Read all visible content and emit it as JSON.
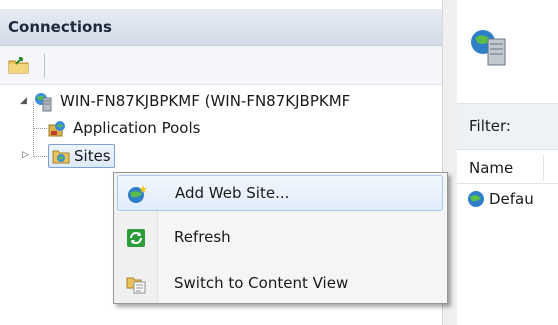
{
  "connections": {
    "title": "Connections",
    "toolbar": {
      "connect_icon": "folder-connect-icon"
    },
    "tree": {
      "server": {
        "label": "WIN-FN87KJBPKMF (WIN-FN87KJBPKMF",
        "icon": "server-icon"
      },
      "app_pools": {
        "label": "Application Pools",
        "icon": "app-pools-icon"
      },
      "sites": {
        "label": "Sites",
        "icon": "sites-folder-icon"
      }
    }
  },
  "main": {
    "icon": "server-icon",
    "filter_label": "Filter:",
    "columns": [
      "Name"
    ],
    "rows": [
      {
        "name": "Defau",
        "icon": "globe-icon"
      }
    ]
  },
  "context_menu": {
    "items": [
      {
        "label": "Add Web Site...",
        "icon": "add-web-site-icon"
      },
      {
        "label": "Refresh",
        "icon": "refresh-icon"
      },
      {
        "label": "Switch to Content View",
        "icon": "content-view-icon"
      }
    ]
  }
}
